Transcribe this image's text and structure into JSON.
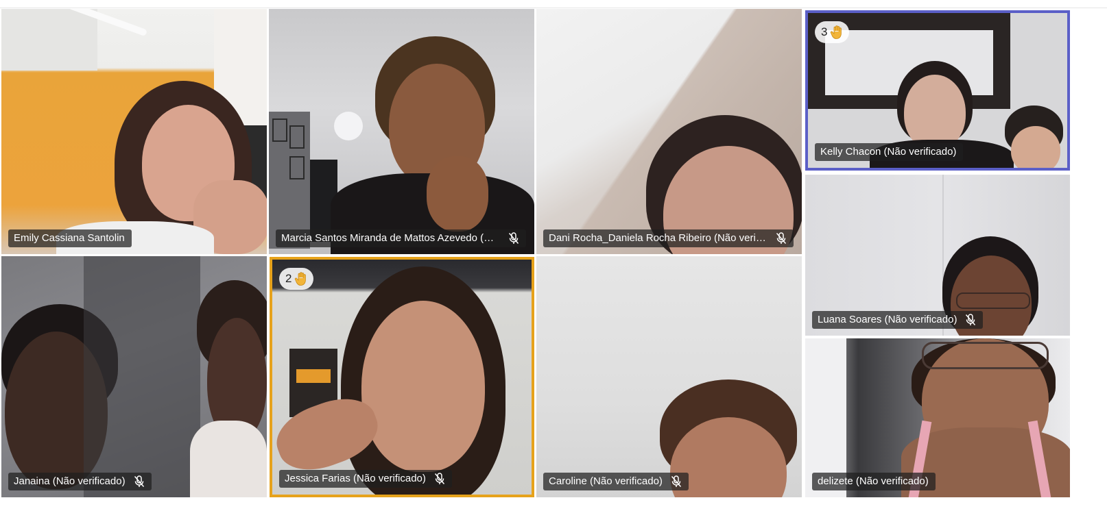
{
  "participants": [
    {
      "name": "Emily Cassiana Santolin",
      "muted": false,
      "hand": ""
    },
    {
      "name": "Marcia Santos Miranda de Mattos Azevedo (Nã...",
      "muted": true,
      "hand": ""
    },
    {
      "name": "Dani Rocha_Daniela Rocha Ribeiro (Não verific...",
      "muted": true,
      "hand": ""
    },
    {
      "name": "Kelly Chacon (Não verificado)",
      "muted": false,
      "hand": "3"
    },
    {
      "name": "Luana Soares (Não verificado)",
      "muted": true,
      "hand": ""
    },
    {
      "name": "Janaina (Não verificado)",
      "muted": true,
      "hand": ""
    },
    {
      "name": "Jessica Farias (Não verificado)",
      "muted": true,
      "hand": "2"
    },
    {
      "name": "Caroline (Não verificado)",
      "muted": true,
      "hand": ""
    },
    {
      "name": "delizete (Não verificado)",
      "muted": false,
      "hand": ""
    }
  ],
  "icons": {
    "mic": "microphone-off-icon",
    "hand": "raised-hand-icon"
  },
  "colors": {
    "active_speaker_blue": "#5b5fc7",
    "active_speaker_orange": "#e6a21b",
    "hand_emoji": "#f2b53a"
  }
}
